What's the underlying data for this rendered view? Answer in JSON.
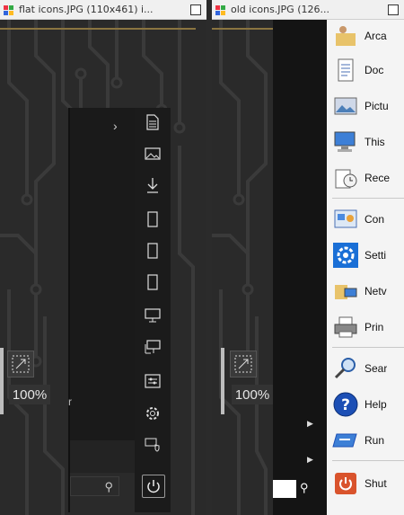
{
  "left_window": {
    "title": "flat icons.JPG (110x461) i...",
    "zoom_percent": "100%",
    "chevron": "›",
    "stray_char": "r",
    "search_icon": "magnifier-icon",
    "sidebar_icons": [
      "document-icon",
      "pictures-icon",
      "downloads-icon",
      "blank-page-icon",
      "blank-page-icon",
      "blank-page-icon",
      "computer-icon",
      "network-computer-icon",
      "control-panel-icon",
      "settings-gear-icon",
      "shield-icon",
      "power-icon"
    ]
  },
  "right_window": {
    "title": "old icons.JPG (126...",
    "zoom_percent": "100%",
    "menu_items": [
      {
        "label": "Arca",
        "icon": "folder-user-icon"
      },
      {
        "label": "Doc",
        "icon": "documents-icon"
      },
      {
        "label": "Pictu",
        "icon": "pictures-icon"
      },
      {
        "label": "This",
        "icon": "computer-icon"
      },
      {
        "label": "Rece",
        "icon": "recent-icon"
      },
      {
        "label": "Con",
        "icon": "control-panel-icon"
      },
      {
        "label": "Setti",
        "icon": "settings-gear-icon"
      },
      {
        "label": "Netv",
        "icon": "network-icon"
      },
      {
        "label": "Prin",
        "icon": "printer-icon"
      },
      {
        "label": "Sear",
        "icon": "search-icon"
      },
      {
        "label": "Help",
        "icon": "help-icon"
      },
      {
        "label": "Run",
        "icon": "run-icon"
      },
      {
        "label": "Shut",
        "icon": "shutdown-icon"
      }
    ]
  },
  "colors": {
    "background": "#2a2a2a",
    "gold_line": "#8a7440",
    "titlebar": "#f0f0f0"
  }
}
